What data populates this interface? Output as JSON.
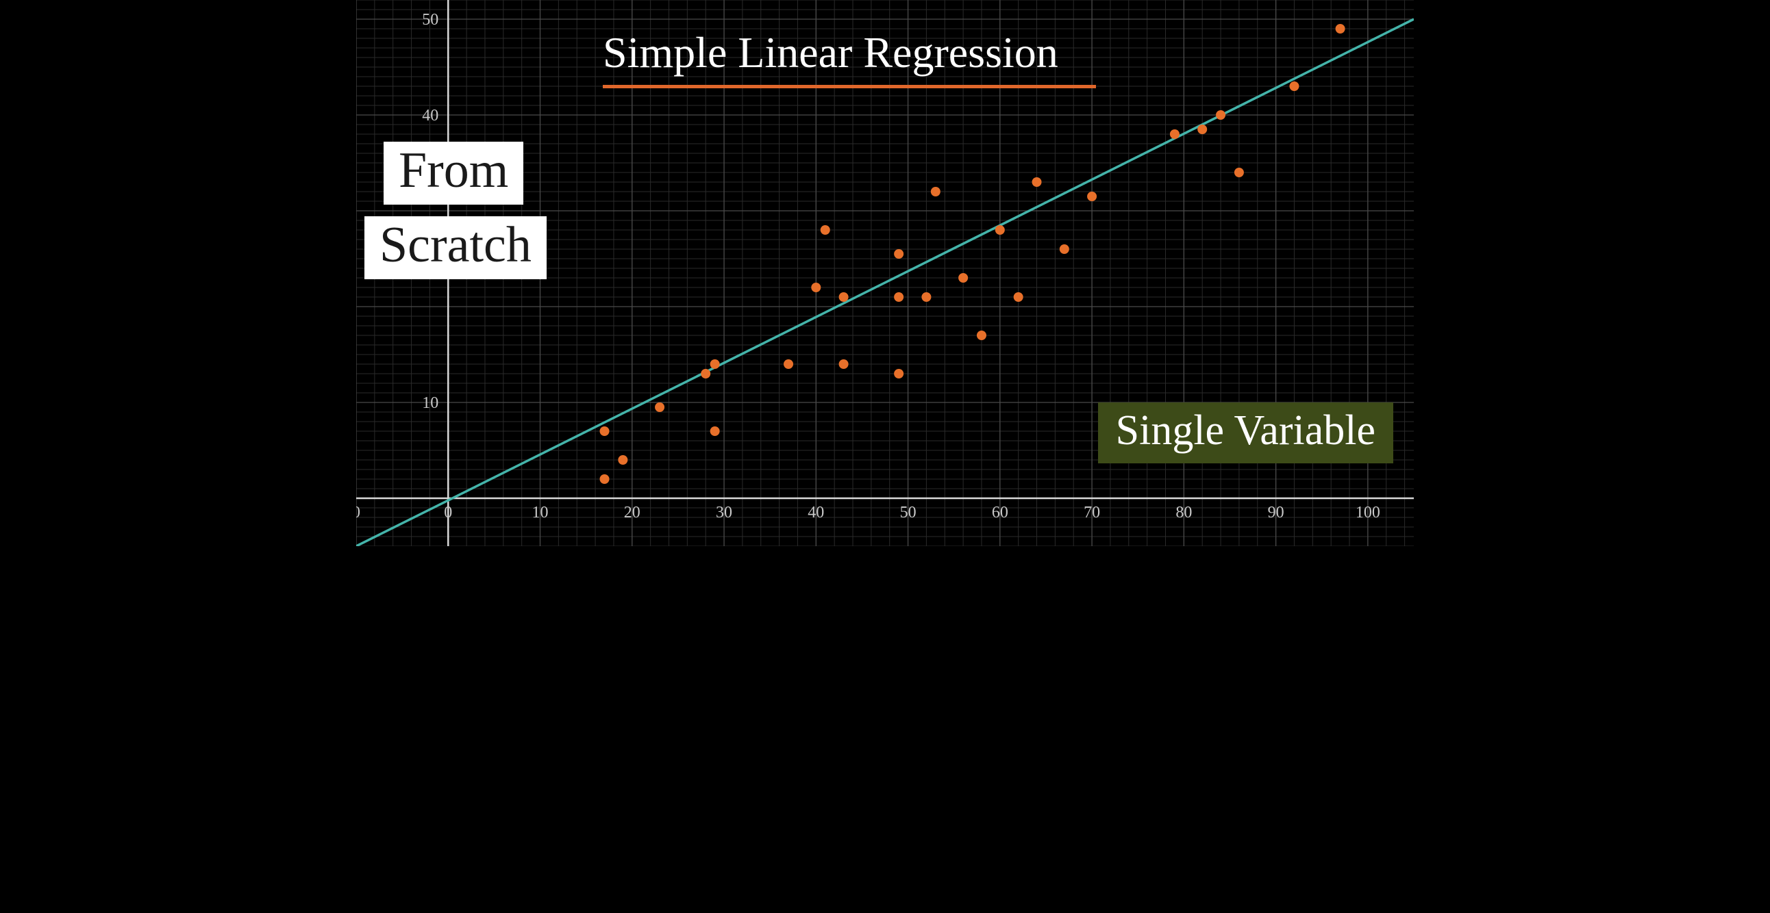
{
  "title": "Simple Linear Regression",
  "subtitle_from": "From",
  "subtitle_scratch": "Scratch",
  "badge": "Single Variable",
  "chart_data": {
    "type": "scatter",
    "title": "Simple Linear Regression",
    "xlabel": "",
    "ylabel": "",
    "xlim": [
      -10,
      105
    ],
    "ylim": [
      -5,
      52
    ],
    "x_ticks": [
      "0",
      "0",
      "10",
      "20",
      "30",
      "40",
      "50",
      "60",
      "70",
      "80",
      "90",
      "100"
    ],
    "y_ticks": [
      "10",
      "40",
      "50"
    ],
    "grid": true,
    "regression_line": {
      "x1": -10,
      "y1": -5,
      "x2": 105,
      "y2": 50,
      "color": "#44b4aa"
    },
    "series": [
      {
        "name": "points",
        "color": "#e8702a",
        "points": [
          {
            "x": 17,
            "y": 2
          },
          {
            "x": 17,
            "y": 7
          },
          {
            "x": 19,
            "y": 4
          },
          {
            "x": 23,
            "y": 9.5
          },
          {
            "x": 28,
            "y": 13
          },
          {
            "x": 29,
            "y": 7
          },
          {
            "x": 29,
            "y": 14
          },
          {
            "x": 37,
            "y": 14
          },
          {
            "x": 40,
            "y": 22
          },
          {
            "x": 41,
            "y": 28
          },
          {
            "x": 43,
            "y": 21
          },
          {
            "x": 43,
            "y": 14
          },
          {
            "x": 49,
            "y": 13
          },
          {
            "x": 49,
            "y": 21
          },
          {
            "x": 49,
            "y": 25.5
          },
          {
            "x": 52,
            "y": 21
          },
          {
            "x": 53,
            "y": 32
          },
          {
            "x": 56,
            "y": 23
          },
          {
            "x": 58,
            "y": 17
          },
          {
            "x": 60,
            "y": 28
          },
          {
            "x": 62,
            "y": 21
          },
          {
            "x": 64,
            "y": 33
          },
          {
            "x": 67,
            "y": 26
          },
          {
            "x": 70,
            "y": 31.5
          },
          {
            "x": 79,
            "y": 38
          },
          {
            "x": 82,
            "y": 38.5
          },
          {
            "x": 84,
            "y": 40
          },
          {
            "x": 86,
            "y": 34
          },
          {
            "x": 92,
            "y": 43
          },
          {
            "x": 97,
            "y": 49
          }
        ]
      }
    ]
  }
}
